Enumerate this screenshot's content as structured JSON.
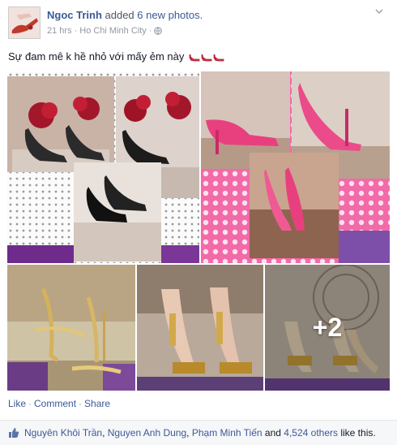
{
  "post": {
    "author": "Ngoc Trinh",
    "action_prefix": "added",
    "photo_count_label": "6 new photos",
    "action_suffix": ".",
    "time": "21 hrs",
    "meta_separator": "·",
    "location": "Ho Chi Minh City",
    "meta_separator_2": "·",
    "privacy_icon": "globe-icon",
    "menu_icon": "chevron-down-icon",
    "text": "Sự đam mê k hề nhỏ với mấy ẻm này",
    "emoji": "high-heel-shoe-icon x3"
  },
  "photos": {
    "more_count": "+2"
  },
  "actions": {
    "like": "Like",
    "sep1": "·",
    "comment": "Comment",
    "sep2": "·",
    "share": "Share"
  },
  "likes": {
    "icon": "thumbs-up-icon",
    "user1": "Nguyên Khôi Trần",
    "comma1": ",",
    "user2": "Nguyen Anh Dung",
    "comma2": ",",
    "user3": "Phạm Minh Tiến",
    "and_text": "and",
    "others": "4,524 others",
    "suffix": "like this."
  },
  "colors": {
    "link": "#3b5998",
    "meta": "#9197a3",
    "likes_bg": "#f6f7f9"
  }
}
